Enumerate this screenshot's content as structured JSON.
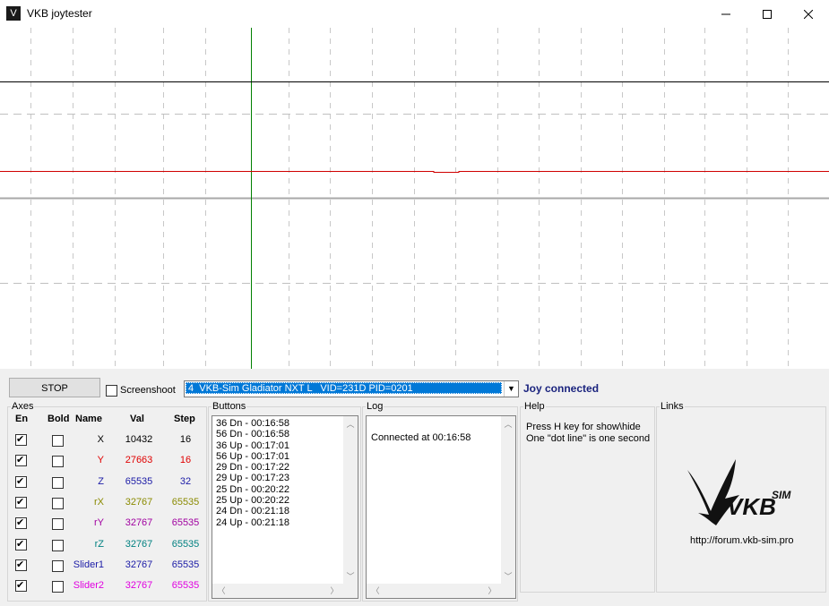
{
  "window": {
    "title": "VKB joytester",
    "icon_glyph": "V"
  },
  "toolbar": {
    "stop_label": "STOP",
    "screenshoot_label": "Screenshoot",
    "screenshoot_checked": false,
    "device": "4  VKB-Sim Gladiator NXT L   VID=231D PID=0201",
    "status": "Joy connected",
    "status_color": "#1a237e"
  },
  "axes": {
    "title": "Axes",
    "headers": {
      "en": "En",
      "bold": "Bold",
      "name": "Name",
      "val": "Val",
      "step": "Step"
    },
    "rows": [
      {
        "name": "X",
        "val": "10432",
        "step": "16",
        "color": "#000000"
      },
      {
        "name": "Y",
        "val": "27663",
        "step": "16",
        "color": "#e00000"
      },
      {
        "name": "Z",
        "val": "65535",
        "step": "32",
        "color": "#1a1aa6"
      },
      {
        "name": "rX",
        "val": "32767",
        "step": "65535",
        "color": "#8a8a00"
      },
      {
        "name": "rY",
        "val": "32767",
        "step": "65535",
        "color": "#a000a0"
      },
      {
        "name": "rZ",
        "val": "32767",
        "step": "65535",
        "color": "#008080"
      },
      {
        "name": "Slider1",
        "val": "32767",
        "step": "65535",
        "color": "#1a1aa6"
      },
      {
        "name": "Slider2",
        "val": "32767",
        "step": "65535",
        "color": "#e000e0"
      }
    ]
  },
  "buttons": {
    "title": "Buttons",
    "items": [
      "36 Dn - 00:16:58",
      "56 Dn - 00:16:58",
      "36 Up - 00:17:01",
      "56 Up - 00:17:01",
      "29 Dn - 00:17:22",
      "29 Up - 00:17:23",
      "25 Dn - 00:20:22",
      "25 Up - 00:20:22",
      "24 Dn - 00:21:18",
      "24 Up - 00:21:18"
    ]
  },
  "log": {
    "title": "Log",
    "text": "Connected at 00:16:58"
  },
  "help": {
    "title": "Help",
    "line1": "Press H key for show\\hide",
    "line2": "One \"dot line\" is one second"
  },
  "links": {
    "title": "Links",
    "url": "http://forum.vkb-sim.pro",
    "logo_text": "VKB",
    "logo_suffix": "SIM"
  }
}
